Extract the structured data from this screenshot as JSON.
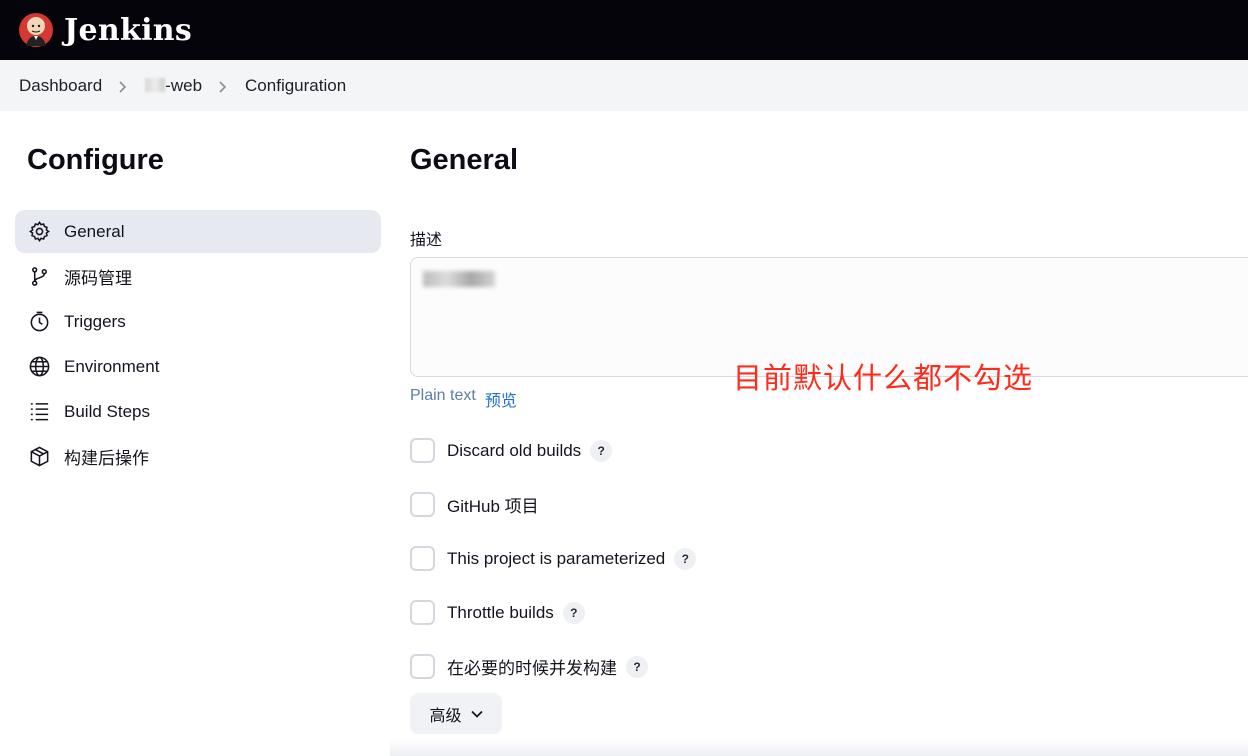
{
  "header": {
    "app_name": "Jenkins",
    "logo_icon": "jenkins-butler-logo"
  },
  "breadcrumb": {
    "items": [
      "Dashboard",
      "-web",
      "Configuration"
    ]
  },
  "sidebar": {
    "title": "Configure",
    "items": [
      {
        "label": "General",
        "icon": "gear-icon",
        "active": true
      },
      {
        "label": "源码管理",
        "icon": "git-branch-icon"
      },
      {
        "label": "Triggers",
        "icon": "timer-icon"
      },
      {
        "label": "Environment",
        "icon": "globe-icon"
      },
      {
        "label": "Build Steps",
        "icon": "list-steps-icon"
      },
      {
        "label": "构建后操作",
        "icon": "package-icon"
      }
    ]
  },
  "main": {
    "title": "General",
    "description_label": "描述",
    "description_value": "",
    "format_plain": "Plain text",
    "format_preview": "预览",
    "options": [
      {
        "label": "Discard old builds",
        "checked": false,
        "help": "?"
      },
      {
        "label": "GitHub 项目",
        "checked": false
      },
      {
        "label": "This project is parameterized",
        "checked": false,
        "help": "?"
      },
      {
        "label": "Throttle builds",
        "checked": false,
        "help": "?"
      },
      {
        "label": "在必要的时候并发构建",
        "checked": false,
        "help": "?"
      }
    ],
    "advanced_button": "高级"
  },
  "annotation": {
    "text": "目前默认什么都不勾选",
    "color": "#ff2a1a"
  }
}
